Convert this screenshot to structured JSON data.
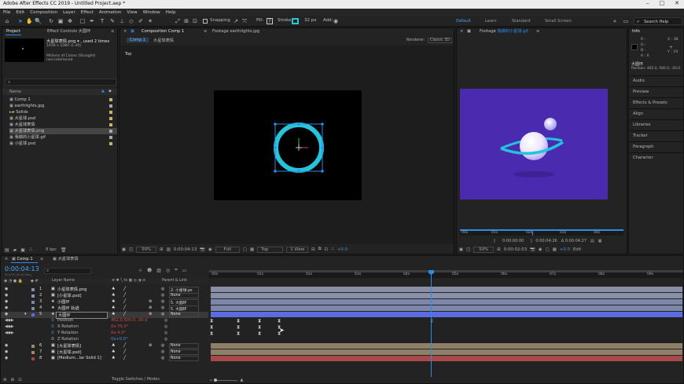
{
  "app": {
    "title": "Adobe After Effects CC 2019 - Untitled Project.aep *",
    "window_controls": [
      "–",
      "□",
      "✕"
    ]
  },
  "menu": [
    "File",
    "Edit",
    "Composition",
    "Layer",
    "Effect",
    "Animation",
    "View",
    "Window",
    "Help"
  ],
  "toolbar": {
    "snapping": "Snapping",
    "fill": "Fill:",
    "stroke": "Stroke:",
    "stroke_px": "32 px",
    "add": "Add:",
    "workspaces": [
      "Default",
      "Learn",
      "Standard",
      "Small Screen"
    ],
    "search_help": "Search Help"
  },
  "project": {
    "tab": "Project",
    "effect_controls_tab": "Effect Controls 大圆环",
    "selected_name": "大星球表情.png ▾ , used 2 times",
    "selected_info1": "1930 x 1080 (1.00)",
    "selected_info2": "Millions of Colors (Straight)",
    "selected_info3": "non-interlaced",
    "search_placeholder": "",
    "col_name": "Name",
    "items": [
      {
        "name": "Comp 1",
        "color": "#c9b26b"
      },
      {
        "name": "earthlights.jpg",
        "color": "#a9a9a9"
      },
      {
        "name": "Solids",
        "color": "#d3b25e"
      },
      {
        "name": "大星球.psd",
        "color": "#c9b26b"
      },
      {
        "name": "大星球表情",
        "color": "#c9b26b"
      },
      {
        "name": "大星球表情.png",
        "color": "#a9a9a9"
      },
      {
        "name": "我做的小星球.gif",
        "color": "#a9a9a9"
      },
      {
        "name": "小星球.psd",
        "color": "#c9b26b"
      }
    ],
    "bpc": "8 bpc"
  },
  "composition": {
    "tab": "Composition Comp 1",
    "footage_tab": "Footage earthlights.jpg",
    "subtab1": "Comp 1",
    "subtab2": "大星球表情",
    "renderer_label": "Renderer:",
    "renderer": "Classic 3D",
    "view_label": "Top",
    "footer": {
      "zoom": "50%",
      "time": "0:00:04:13",
      "res": "Full",
      "view": "Top",
      "views": "1 View",
      "exposure": "+0.0"
    }
  },
  "footage": {
    "tab": "Footage 我做的小星球.gif",
    "ruler": [
      "00s",
      "01s",
      "02s",
      "03s",
      "04s"
    ],
    "in_time": "0:00:00:00",
    "out_time": "0:00:04:26",
    "dur_time": "Δ 0:00:04:27",
    "zoom": "50%",
    "time": "0:00:02:03",
    "exposure": "+0.0",
    "edit": "Edit"
  },
  "info": {
    "tab": "Info",
    "r": "R :",
    "g": "G :",
    "b": "B :",
    "a": "A : 0",
    "x": "X : 38",
    "y": "Y : 19",
    "layer_name": "大圆环",
    "position": "Position: 462.0, 500.0, -20.0",
    "sections": [
      "Audio",
      "Preview",
      "Effects & Presets",
      "Align",
      "Libraries",
      "Tracker",
      "Paragraph",
      "Character"
    ]
  },
  "timeline": {
    "tab_comp": "Comp 1",
    "tab_other": "大星球表情",
    "current_time": "0:00:04:13",
    "frame_info": "00133 (30.00 fps)",
    "col_layer_name": "Layer Name",
    "col_parent": "Parent & Link",
    "ruler": [
      "00s",
      "01s",
      "02s",
      "03s",
      "04s",
      "05s",
      "06s",
      "07s",
      "08s",
      "09s"
    ],
    "layers": [
      {
        "num": "1",
        "name": "小星球表情.png",
        "parent": "2. 小星球.ps",
        "bar": "#8a8fa8"
      },
      {
        "num": "2",
        "name": "[小星球.psd]",
        "parent": "None",
        "bar": "#8a8fa8"
      },
      {
        "num": "3",
        "name": "小圆环",
        "parent": "5. 大圆环",
        "bar": "#7b86a8"
      },
      {
        "num": "4",
        "name": "大圆环 轨迹",
        "parent": "5. 大圆环",
        "bar": "#7b86a8"
      },
      {
        "num": "5",
        "name": "大圆环",
        "parent": "None",
        "bar": "#5b6ce0"
      }
    ],
    "transform": [
      {
        "name": "Position",
        "value": "462.0,500.0,-20.0"
      },
      {
        "name": "X Rotation",
        "value": "0x-75.0°"
      },
      {
        "name": "Y Rotation",
        "value": "0x-4.0°"
      },
      {
        "name": "Z Rotation",
        "value": "0x+0.0°"
      }
    ],
    "layers_bottom": [
      {
        "num": "6",
        "name": "[大星球表情]",
        "parent": "None",
        "bar": "#9a8a6a"
      },
      {
        "num": "7",
        "name": "[大星球.psd]",
        "parent": "None",
        "bar": "#9a8a6a"
      },
      {
        "num": "8",
        "name": "[Medium...lar Solid 1]",
        "parent": "None",
        "bar": "#b24040"
      }
    ],
    "toggle_label": "Toggle Switches / Modes"
  }
}
